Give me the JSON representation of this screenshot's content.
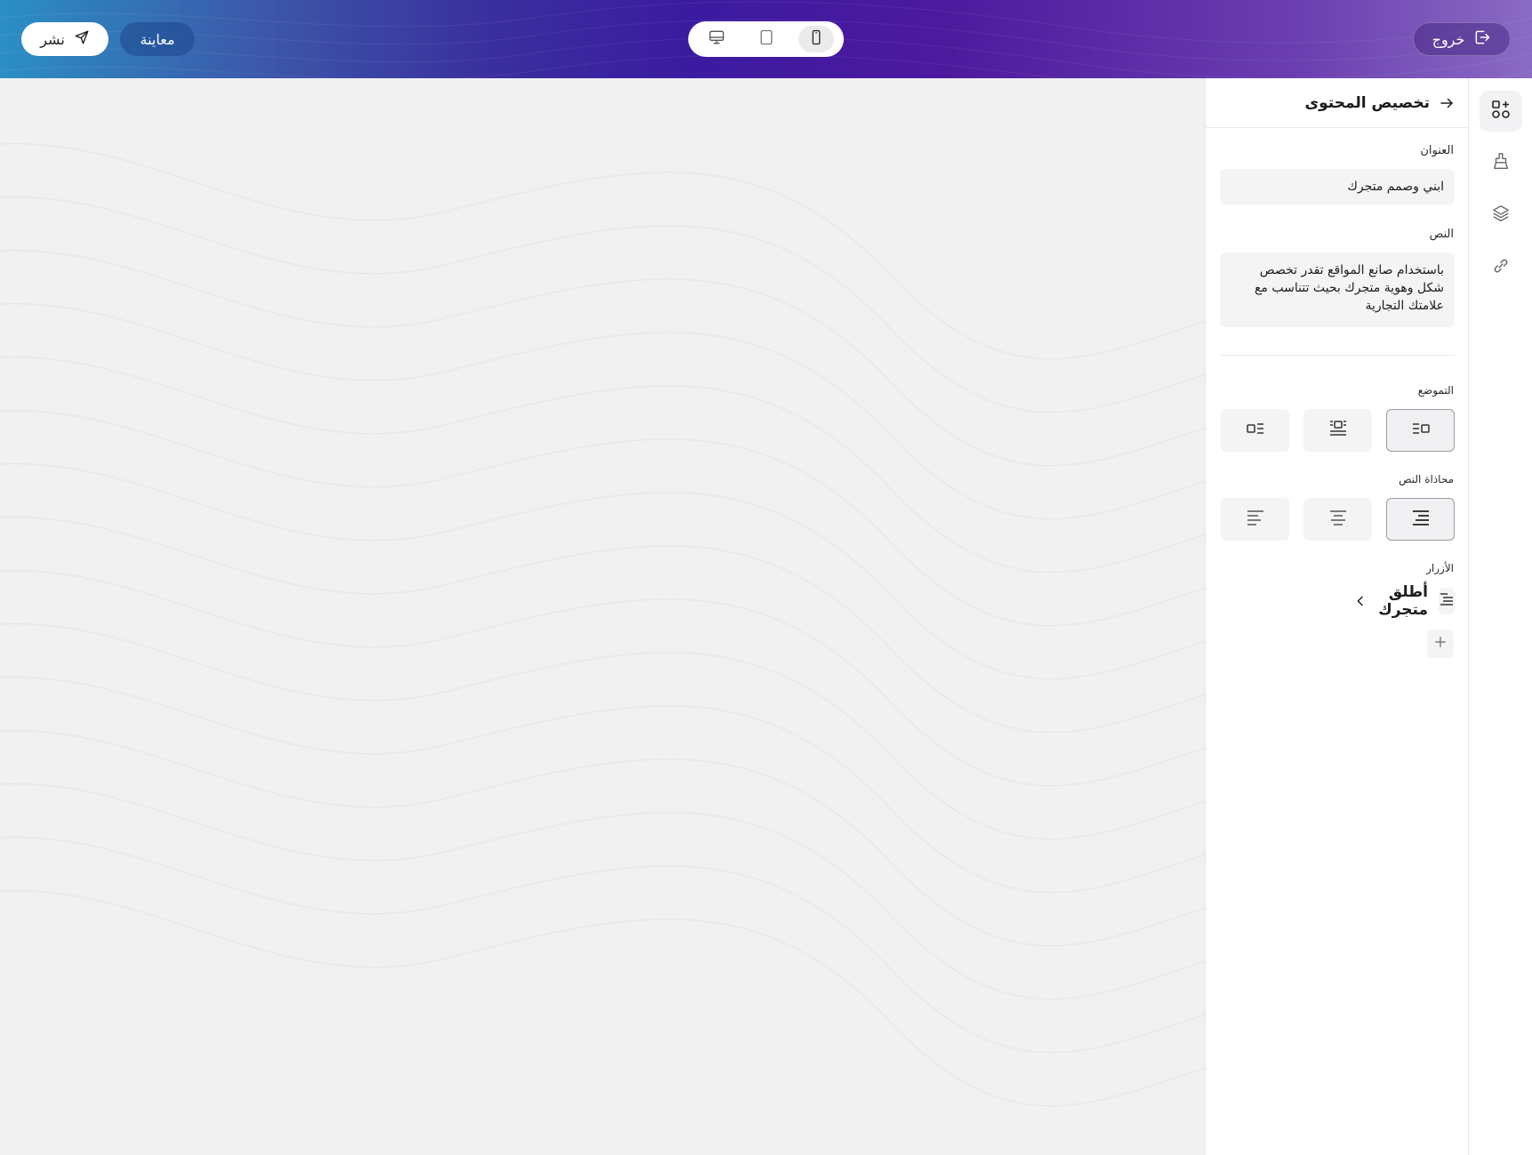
{
  "header": {
    "publish_label": "نشر",
    "preview_label": "معاينة",
    "exit_label": "خروج",
    "devices": [
      {
        "name": "desktop",
        "icon": "monitor-icon",
        "active": false
      },
      {
        "name": "tablet",
        "icon": "tablet-icon",
        "active": false
      },
      {
        "name": "mobile",
        "icon": "smartphone-icon",
        "active": true
      }
    ]
  },
  "rail": {
    "items": [
      {
        "icon": "add-section-icon",
        "active": true
      },
      {
        "icon": "paint-brush-icon",
        "active": false
      },
      {
        "icon": "layers-icon",
        "active": false
      },
      {
        "icon": "link-icon",
        "active": false
      }
    ]
  },
  "panel": {
    "title": "تخصيص المحتوى",
    "back_icon": "arrow-right-icon",
    "heading_label": "العنوان",
    "heading_value": "ابني وصمم متجرك",
    "text_label": "النص",
    "text_value": "باستخدام صانع المواقع تقدر تخصص شكل وهوية متجرك بحيث تتناسب مع علامتك التجارية",
    "position_label": "التموضع",
    "position_options": [
      "media-left",
      "media-top",
      "media-right"
    ],
    "position_selected": 0,
    "align_label": "محاذاة النص",
    "align_options": [
      "align-right",
      "align-center",
      "align-left"
    ],
    "align_selected": 0,
    "buttons_label": "الأزرار",
    "buttons": [
      {
        "label": "أطلق متجرك"
      }
    ]
  },
  "colors": {
    "accent_purple": "#3b1ba0",
    "accent_blue": "#2b8fc4",
    "panel_bg": "#ffffff",
    "canvas_bg": "#f1f1f1",
    "field_bg": "#f4f4f5"
  }
}
